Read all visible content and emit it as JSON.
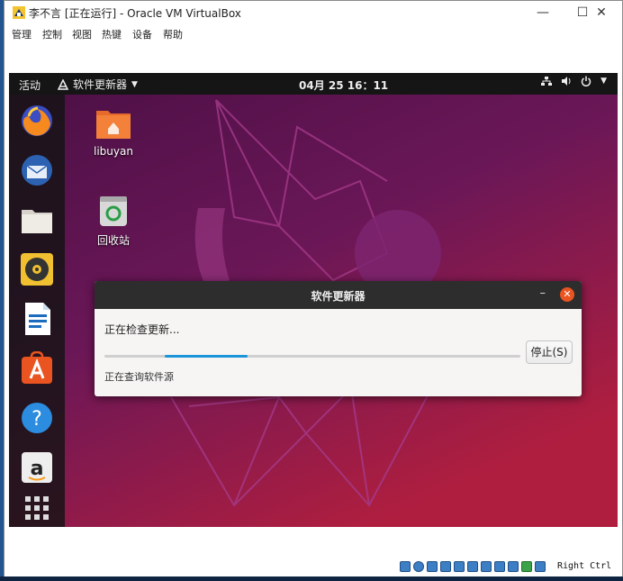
{
  "vbox": {
    "title": "李不言 [正在运行] - Oracle VM VirtualBox",
    "controls": {
      "minimize": "—",
      "maximize": "☐",
      "close": "✕"
    },
    "menu": [
      "管理",
      "控制",
      "视图",
      "热键",
      "设备",
      "帮助"
    ]
  },
  "guest": {
    "topbar": {
      "activities": "活动",
      "app_menu": "软件更新器",
      "clock": "04月 25  16：11"
    },
    "desktop_icons": [
      {
        "label": "libuyan",
        "icon": "home-folder-icon"
      },
      {
        "label": "回收站",
        "icon": "trash-icon"
      }
    ],
    "dock": [
      "firefox-icon",
      "thunderbird-icon",
      "files-icon",
      "rhythmbox-icon",
      "libreoffice-writer-icon",
      "software-center-icon",
      "help-icon",
      "amazon-icon",
      "show-apps-icon"
    ],
    "dialog": {
      "title": "软件更新器",
      "status": "正在检查更新...",
      "stop_label": "停止(S)",
      "substatus": "正在查询软件源",
      "progress_start": 0.145,
      "progress_end": 0.345
    }
  },
  "statusbar": {
    "host_key": "Right Ctrl"
  },
  "colors": {
    "ubuntu_orange": "#e95420",
    "progress_blue": "#1c95d8"
  }
}
